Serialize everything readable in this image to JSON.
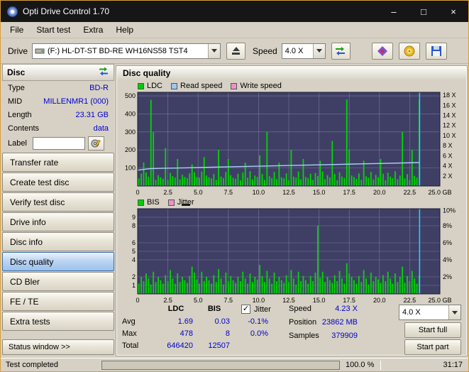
{
  "window": {
    "title": "Opti Drive Control 1.70",
    "minimize": "–",
    "maximize": "□",
    "close": "×"
  },
  "menu": {
    "items": [
      "File",
      "Start test",
      "Extra",
      "Help"
    ]
  },
  "toolbar": {
    "drive_label": "Drive",
    "drive_value": "(F:)  HL-DT-ST BD-RE  WH16NS58 TST4",
    "speed_label": "Speed",
    "speed_value": "4.0 X"
  },
  "sidebar": {
    "disc_header": "Disc",
    "info": [
      {
        "label": "Type",
        "value": "BD-R"
      },
      {
        "label": "MID",
        "value": "MILLENMR1 (000)"
      },
      {
        "label": "Length",
        "value": "23.31 GB"
      },
      {
        "label": "Contents",
        "value": "data"
      }
    ],
    "label_row": {
      "label": "Label",
      "value": ""
    },
    "buttons": [
      "Transfer rate",
      "Create test disc",
      "Verify test disc",
      "Drive info",
      "Disc info",
      "Disc quality",
      "CD Bler",
      "FE / TE",
      "Extra tests"
    ],
    "active_button": "Disc quality",
    "status_window": "Status window >>"
  },
  "main": {
    "title": "Disc quality",
    "legend_top": [
      "LDC",
      "Read speed",
      "Write speed"
    ],
    "legend_bottom": [
      "BIS",
      "Jitter"
    ]
  },
  "stats": {
    "col_ldc": "LDC",
    "col_bis": "BIS",
    "rows": [
      {
        "label": "Avg",
        "ldc": "1.69",
        "bis": "0.03"
      },
      {
        "label": "Max",
        "ldc": "478",
        "bis": "8"
      },
      {
        "label": "Total",
        "ldc": "646420",
        "bis": "12507"
      }
    ],
    "jitter_label": "Jitter",
    "jitter_check": "✓",
    "jitter_values": [
      "-0.1%",
      "0.0%"
    ],
    "speed_label": "Speed",
    "speed_value": "4.23 X",
    "position_label": "Position",
    "position_value": "23862 MB",
    "samples_label": "Samples",
    "samples_value": "379909",
    "speed_select": "4.0 X",
    "start_full": "Start full",
    "start_part": "Start part"
  },
  "statusbar": {
    "text": "Test completed",
    "progress_pct": 100,
    "progress_label": "100.0 %",
    "time": "31:17"
  },
  "chart_data": [
    {
      "type": "bar",
      "title": "Disc quality - LDC with read speed",
      "x_max": 25,
      "bar_step": 0.2,
      "y_max": 520,
      "bg": "#3f3f66",
      "grid_color": "#9393bc",
      "bar_color": "#00d800",
      "legend": [
        "LDC",
        "Read speed",
        "Write speed"
      ],
      "legend_colors": [
        "#00cc00",
        "#9cc8f2",
        "#f090c8"
      ],
      "x_ticks": [
        {
          "x": 0,
          "label": "0"
        },
        {
          "x": 2.5,
          "label": "2.5"
        },
        {
          "x": 5,
          "label": "5.0"
        },
        {
          "x": 7.5,
          "label": "7.5"
        },
        {
          "x": 10,
          "label": "10.0"
        },
        {
          "x": 12.5,
          "label": "12.5"
        },
        {
          "x": 15,
          "label": "15.0"
        },
        {
          "x": 17.5,
          "label": "17.5"
        },
        {
          "x": 20,
          "label": "20.0"
        },
        {
          "x": 22.5,
          "label": "22.5"
        },
        {
          "x": 25,
          "label": "25.0 GB"
        }
      ],
      "left_ticks": [
        {
          "v": 500,
          "label": "500"
        },
        {
          "v": 400,
          "label": "400"
        },
        {
          "v": 300,
          "label": "300"
        },
        {
          "v": 200,
          "label": "200"
        },
        {
          "v": 100,
          "label": "100"
        }
      ],
      "right_ticks": [
        {
          "v": 504,
          "label": "18 X"
        },
        {
          "v": 448,
          "label": "16 X"
        },
        {
          "v": 392,
          "label": "14 X"
        },
        {
          "v": 336,
          "label": "12 X"
        },
        {
          "v": 280,
          "label": "10 X"
        },
        {
          "v": 224,
          "label": "8 X"
        },
        {
          "v": 168,
          "label": "6 X"
        },
        {
          "v": 112,
          "label": "4 X"
        },
        {
          "v": 56,
          "label": "2 X"
        }
      ],
      "bars": [
        42,
        68,
        130,
        75,
        52,
        478,
        300,
        34,
        60,
        48,
        40,
        210,
        34,
        72,
        55,
        46,
        150,
        36,
        62,
        50,
        44,
        70,
        120,
        76,
        50,
        46,
        80,
        160,
        58,
        48,
        42,
        66,
        34,
        200,
        52,
        44,
        78,
        150,
        60,
        46,
        40,
        68,
        32,
        74,
        130,
        46,
        82,
        36,
        58,
        50,
        170,
        66,
        34,
        300,
        54,
        44,
        78,
        38,
        130,
        48,
        42,
        70,
        32,
        200,
        52,
        46,
        80,
        36,
        150,
        50,
        44,
        68,
        34,
        72,
        56,
        140,
        80,
        38,
        60,
        48,
        250,
        66,
        32,
        76,
        52,
        44,
        480,
        200,
        58,
        50,
        40,
        70,
        34,
        140,
        54,
        46,
        78,
        36,
        62,
        48,
        150,
        68,
        32,
        74,
        52,
        44,
        82,
        38,
        58,
        300,
        42,
        66,
        34,
        200,
        56,
        46,
        480
      ],
      "line": {
        "color": "#a8d0f8",
        "points": [
          [
            0,
            88
          ],
          [
            1,
            96
          ],
          [
            2,
            98
          ],
          [
            4,
            101
          ],
          [
            6,
            104
          ],
          [
            8,
            107
          ],
          [
            10,
            110
          ],
          [
            12,
            113
          ],
          [
            14,
            116
          ],
          [
            16,
            119
          ],
          [
            18,
            122
          ],
          [
            20,
            125
          ],
          [
            22,
            128
          ],
          [
            23.3,
            130
          ]
        ]
      },
      "marker": {
        "x": 23.32,
        "color": "#00e8ff"
      }
    },
    {
      "type": "bar",
      "title": "Disc quality - BIS with jitter",
      "x_max": 25,
      "bar_step": 0.2,
      "y_max": 10,
      "bg": "#3f3f66",
      "grid_color": "#9393bc",
      "bar_color": "#00d800",
      "legend": [
        "BIS",
        "Jitter"
      ],
      "legend_colors": [
        "#00cc00",
        "#f090c8"
      ],
      "x_ticks": [
        {
          "x": 0,
          "label": "0"
        },
        {
          "x": 2.5,
          "label": "2.5"
        },
        {
          "x": 5,
          "label": "5.0"
        },
        {
          "x": 7.5,
          "label": "7.5"
        },
        {
          "x": 10,
          "label": "10.0"
        },
        {
          "x": 12.5,
          "label": "12.5"
        },
        {
          "x": 15,
          "label": "15.0"
        },
        {
          "x": 17.5,
          "label": "17.5"
        },
        {
          "x": 20,
          "label": "20.0"
        },
        {
          "x": 22.5,
          "label": "22.5"
        },
        {
          "x": 25,
          "label": "25.0 GB"
        }
      ],
      "left_ticks": [
        {
          "v": 9,
          "label": "9"
        },
        {
          "v": 8,
          "label": "8"
        },
        {
          "v": 6,
          "label": "6"
        },
        {
          "v": 5,
          "label": "5"
        },
        {
          "v": 4,
          "label": "4"
        },
        {
          "v": 2,
          "label": "2"
        },
        {
          "v": 1,
          "label": "1"
        }
      ],
      "right_ticks": [
        {
          "v": 9.8,
          "label": "10%"
        },
        {
          "v": 8,
          "label": "8%"
        },
        {
          "v": 6,
          "label": "6%"
        },
        {
          "v": 4,
          "label": "4%"
        },
        {
          "v": 2,
          "label": "2%"
        }
      ],
      "bars": [
        1.2,
        2.0,
        1.5,
        2.4,
        1.8,
        1.1,
        2.6,
        1.4,
        2.0,
        1.6,
        1.2,
        2.2,
        1.5,
        2.8,
        1.8,
        1.2,
        2.4,
        1.4,
        2.0,
        1.6,
        1.3,
        2.1,
        3.2,
        2.5,
        1.7,
        1.2,
        2.6,
        1.5,
        2.0,
        1.6,
        1.2,
        2.2,
        1.4,
        2.9,
        1.8,
        1.1,
        2.5,
        1.5,
        2.1,
        1.6,
        1.3,
        2.0,
        1.5,
        2.6,
        1.8,
        1.2,
        2.4,
        1.4,
        2.0,
        1.7,
        3.4,
        2.1,
        1.4,
        2.7,
        1.8,
        1.2,
        2.5,
        1.5,
        2.0,
        1.6,
        1.3,
        2.2,
        1.4,
        2.8,
        1.8,
        1.1,
        2.6,
        1.5,
        2.1,
        1.6,
        1.2,
        2.1,
        1.5,
        2.5,
        8.0,
        1.9,
        2.6,
        1.4,
        2.0,
        1.6,
        1.3,
        2.2,
        1.5,
        2.7,
        1.8,
        1.2,
        3.6,
        2.4,
        2.0,
        1.6,
        1.2,
        2.1,
        1.4,
        2.8,
        1.8,
        1.1,
        2.5,
        1.5,
        2.0,
        1.7,
        1.3,
        2.2,
        1.5,
        2.6,
        1.8,
        1.2,
        2.4,
        1.4,
        2.0,
        3.2,
        1.3,
        2.1,
        1.5,
        2.7,
        1.8,
        1.2,
        2.2
      ],
      "marker": {
        "x": 23.32,
        "color": "#00e8ff"
      }
    }
  ]
}
